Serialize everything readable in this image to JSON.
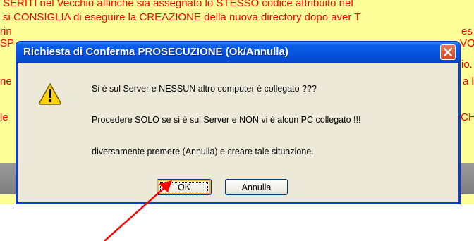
{
  "background": {
    "lines": [
      "SERITI nel Vecchio affinche sia assegnato lo STESSO codice attribuito nel",
      "si CONSIGLIA di eseguire la CREAZIONE della nuova directory dopo aver T"
    ],
    "fragments": [
      "rin",
      "SP",
      "ne",
      "le",
      "es",
      "VO",
      "io.",
      "a l",
      "CH"
    ]
  },
  "dialog": {
    "title": "Richiesta di Conferma PROSECUZIONE (Ok/Annulla)",
    "icon": "warning-icon",
    "messages": [
      "Si è sul Server e NESSUN altro computer è collegato ???",
      "Procedere SOLO se si è sul Server e NON vi è alcun PC collegato !!!",
      "diversamente premere (Annulla) e creare tale situazione."
    ],
    "ok_label": "OK",
    "cancel_label": "Annulla"
  },
  "colors": {
    "background_text": "#ff0000",
    "background_panel": "#ffff99",
    "titlebar": "#0553e0",
    "annotation_arrow": "#ff0000"
  }
}
